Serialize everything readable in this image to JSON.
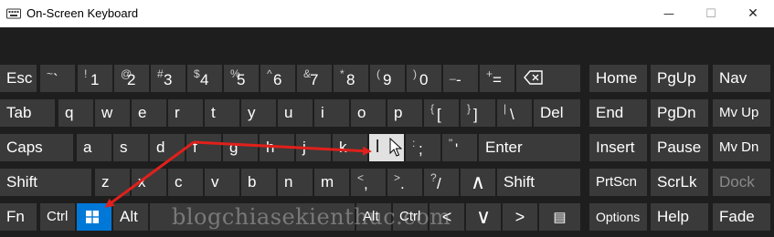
{
  "window": {
    "title": "On-Screen Keyboard",
    "controls": {
      "minimize": "—",
      "maximize": "☐",
      "close": "✕"
    }
  },
  "rows": {
    "numbers": [
      {
        "label": "Esc"
      },
      {
        "primary": "`",
        "secondary": "~"
      },
      {
        "primary": "1",
        "secondary": "!"
      },
      {
        "primary": "2",
        "secondary": "@"
      },
      {
        "primary": "3",
        "secondary": "#"
      },
      {
        "primary": "4",
        "secondary": "$"
      },
      {
        "primary": "5",
        "secondary": "%"
      },
      {
        "primary": "6",
        "secondary": "^"
      },
      {
        "primary": "7",
        "secondary": "&"
      },
      {
        "primary": "8",
        "secondary": "*"
      },
      {
        "primary": "9",
        "secondary": "("
      },
      {
        "primary": "0",
        "secondary": ")"
      },
      {
        "primary": "-",
        "secondary": "_"
      },
      {
        "primary": "=",
        "secondary": "+"
      },
      {
        "label": "⌫"
      }
    ],
    "top": [
      {
        "label": "Tab"
      },
      {
        "label": "q"
      },
      {
        "label": "w"
      },
      {
        "label": "e"
      },
      {
        "label": "r"
      },
      {
        "label": "t"
      },
      {
        "label": "y"
      },
      {
        "label": "u"
      },
      {
        "label": "i"
      },
      {
        "label": "o"
      },
      {
        "label": "p"
      },
      {
        "primary": "[",
        "secondary": "{"
      },
      {
        "primary": "]",
        "secondary": "}"
      },
      {
        "primary": "\\",
        "secondary": "|"
      },
      {
        "label": "Del"
      }
    ],
    "home": [
      {
        "label": "Caps"
      },
      {
        "label": "a"
      },
      {
        "label": "s"
      },
      {
        "label": "d"
      },
      {
        "label": "f"
      },
      {
        "label": "g"
      },
      {
        "label": "h"
      },
      {
        "label": "j"
      },
      {
        "label": "k"
      },
      {
        "label": "l"
      },
      {
        "primary": ";",
        "secondary": ":"
      },
      {
        "primary": "'",
        "secondary": "\""
      },
      {
        "label": "Enter"
      }
    ],
    "shift": [
      {
        "label": "Shift"
      },
      {
        "label": "z"
      },
      {
        "label": "x"
      },
      {
        "label": "c"
      },
      {
        "label": "v"
      },
      {
        "label": "b"
      },
      {
        "label": "n"
      },
      {
        "label": "m"
      },
      {
        "primary": ",",
        "secondary": "<"
      },
      {
        "primary": ".",
        "secondary": ">"
      },
      {
        "primary": "/",
        "secondary": "?"
      },
      {
        "label": "∧"
      },
      {
        "label": "Shift"
      }
    ],
    "bottom": [
      {
        "label": "Fn"
      },
      {
        "label": "Ctrl"
      },
      {
        "label": "⊞"
      },
      {
        "label": "Alt"
      },
      {
        "label": ""
      },
      {
        "label": "Alt"
      },
      {
        "label": "Ctrl"
      },
      {
        "label": "<"
      },
      {
        "label": "∨"
      },
      {
        "label": ">"
      },
      {
        "label": "▤"
      }
    ]
  },
  "right_panel": [
    {
      "label": "Home"
    },
    {
      "label": "PgUp"
    },
    {
      "label": "Nav"
    },
    {
      "label": "End"
    },
    {
      "label": "PgDn"
    },
    {
      "label": "Mv Up"
    },
    {
      "label": "Insert"
    },
    {
      "label": "Pause"
    },
    {
      "label": "Mv Dn"
    },
    {
      "label": "PrtScn"
    },
    {
      "label": "ScrLk"
    },
    {
      "label": "Dock"
    },
    {
      "label": "Options"
    },
    {
      "label": "Help"
    },
    {
      "label": "Fade"
    }
  ],
  "watermark": "blogchiasekienthuc.com",
  "colors": {
    "keyboard_background": "#1e1e1e",
    "key": "#3a3a3a",
    "key_active": "#e1e1e1",
    "windows_key": "#0078d7",
    "arrow": "#e0201b"
  }
}
